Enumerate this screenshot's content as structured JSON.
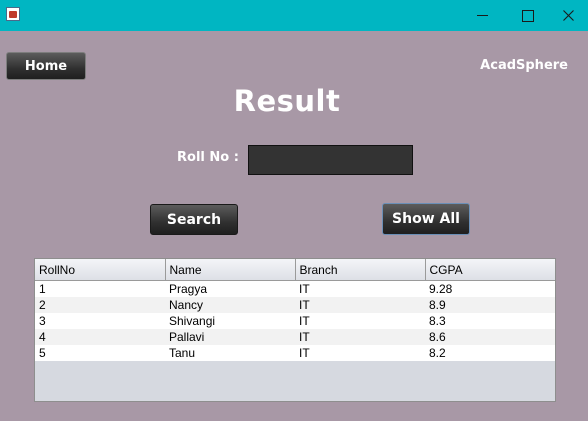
{
  "window": {
    "controls": {
      "minimize": "minimize-icon",
      "maximize": "maximize-icon",
      "close": "close-icon"
    }
  },
  "header": {
    "home_label": "Home",
    "brand": "AcadSphere",
    "title": "Result"
  },
  "form": {
    "roll_label": "Roll No :",
    "roll_value": "",
    "search_label": "Search",
    "show_all_label": "Show All"
  },
  "table": {
    "columns": [
      "RollNo",
      "Name",
      "Branch",
      "CGPA"
    ],
    "rows": [
      [
        "1",
        "Pragya",
        "IT",
        "9.28"
      ],
      [
        "2",
        "Nancy",
        "IT",
        "8.9"
      ],
      [
        "3",
        "Shivangi",
        "IT",
        "8.3"
      ],
      [
        "4",
        "Pallavi",
        "IT",
        "8.6"
      ],
      [
        "5",
        "Tanu",
        "IT",
        "8.2"
      ]
    ]
  },
  "colors": {
    "titlebar": "#00b6c2",
    "background": "#a898a6",
    "button": "#303030",
    "table_empty": "#d6d9e0"
  }
}
